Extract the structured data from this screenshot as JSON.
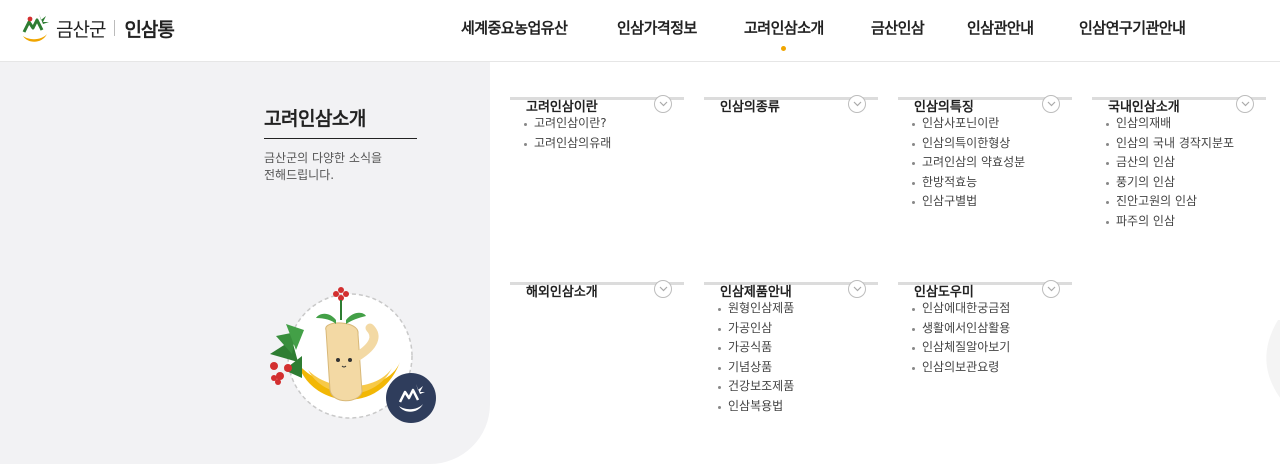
{
  "logo": {
    "county": "금산군",
    "brand": "인삼통"
  },
  "nav": [
    {
      "label": "세계중요농업유산"
    },
    {
      "label": "인삼가격정보"
    },
    {
      "label": "고려인삼소개",
      "active": true
    },
    {
      "label": "금산인삼"
    },
    {
      "label": "인삼관안내"
    },
    {
      "label": "인삼연구기관안내"
    }
  ],
  "panel": {
    "title": "고려인삼소개",
    "desc_line1": "금산군의 다양한 소식을",
    "desc_line2": "전해드립니다."
  },
  "menu": [
    {
      "title": "고려인삼이란",
      "items": [
        "고려인삼이란?",
        "고려인삼의유래"
      ]
    },
    {
      "title": "인삼의종류",
      "items": []
    },
    {
      "title": "인삼의특징",
      "items": [
        "인삼사포닌이란",
        "인삼의특이한형상",
        "고려인삼의 약효성분",
        "한방적효능",
        "인삼구별법"
      ]
    },
    {
      "title": "국내인삼소개",
      "items": [
        "인삼의재배",
        "인삼의 국내 경작지분포",
        "금산의 인삼",
        "풍기의 인삼",
        "진안고원의 인삼",
        "파주의 인삼"
      ]
    },
    {
      "title": "해외인삼소개",
      "items": []
    },
    {
      "title": "인삼제품안내",
      "items": [
        "원형인삼제품",
        "가공인삼",
        "가공식품",
        "기념상품",
        "건강보조제품",
        "인삼복용법"
      ]
    },
    {
      "title": "인삼도우미",
      "items": [
        "인삼에대한궁금점",
        "생활에서인삼활용",
        "인삼체질알아보기",
        "인삼의보관요령"
      ]
    }
  ],
  "icons": {
    "logo": "geumsan-logo-icon",
    "chevron": "chevron-down-icon",
    "mascot": "ginseng-mascot-illustration"
  },
  "colors": {
    "accent": "#f0a500",
    "highlight": "#f8e6a8",
    "panel_bg": "#f2f2f4"
  }
}
